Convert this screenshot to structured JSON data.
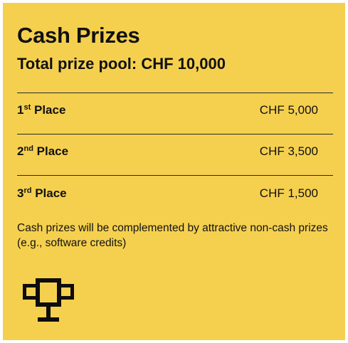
{
  "card": {
    "title": "Cash Prizes",
    "subtitle": "Total prize pool: CHF 10,000",
    "background_color": "#f5d04f"
  },
  "prizes": [
    {
      "rank": "1",
      "suffix": "st",
      "label": "Place",
      "amount": "CHF 5,000"
    },
    {
      "rank": "2",
      "suffix": "nd",
      "label": "Place",
      "amount": "CHF 3,500"
    },
    {
      "rank": "3",
      "suffix": "rd",
      "label": "Place",
      "amount": "CHF 1,500"
    }
  ],
  "note": "Cash prizes will be complemented by attractive non-cash prizes (e.g., software credits)",
  "icon": {
    "name": "trophy-icon"
  }
}
